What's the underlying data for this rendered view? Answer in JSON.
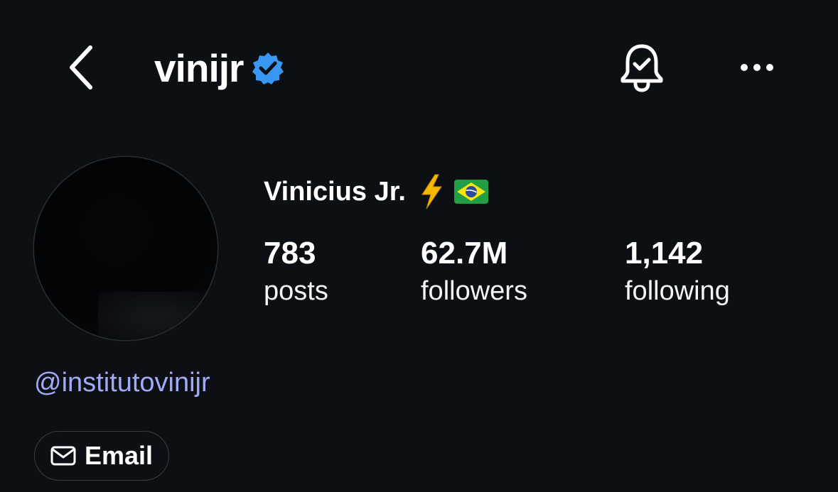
{
  "header": {
    "username": "vinijr",
    "verified": true,
    "icons": {
      "back": "chevron-left-icon",
      "verified": "verified-badge-icon",
      "notifications": "bell-check-icon",
      "more": "more-horizontal-icon"
    }
  },
  "profile": {
    "display_name": "Vinicius Jr.",
    "name_emojis": [
      "lightning-bolt-emoji",
      "brazil-flag-emoji"
    ],
    "stats": {
      "posts": {
        "value": "783",
        "label": "posts"
      },
      "followers": {
        "value": "62.7M",
        "label": "followers"
      },
      "following": {
        "value": "1,142",
        "label": "following"
      }
    },
    "link": "@institutovinijr"
  },
  "actions": {
    "email_label": "Email",
    "email_icon": "mail-icon"
  },
  "colors": {
    "background": "#0c1014",
    "text": "#ffffff",
    "verified_blue": "#3897f0",
    "link": "#a0aaf5",
    "button_border": "#3a3e44"
  }
}
